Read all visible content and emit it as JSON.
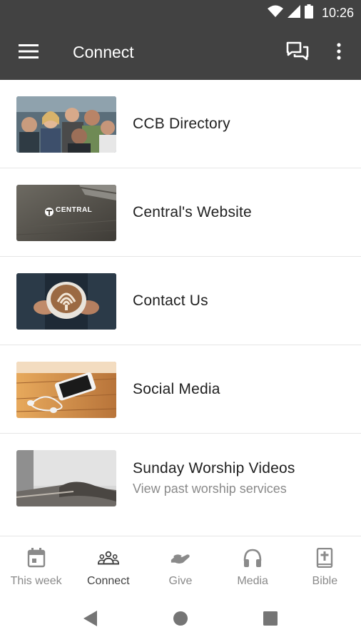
{
  "status_bar": {
    "time": "10:26",
    "icons": [
      "wifi-icon",
      "signal-icon",
      "battery-icon"
    ],
    "background": "#424242"
  },
  "app_bar": {
    "title": "Connect",
    "icons": [
      "menu-icon",
      "chat-icon",
      "more-vert-icon"
    ],
    "background": "#424242"
  },
  "list": {
    "items": [
      {
        "title": "CCB Directory",
        "subtitle": "",
        "thumbnail": "group-people-photo"
      },
      {
        "title": "Central's Website",
        "subtitle": "",
        "thumbnail": "central-logo-photo",
        "thumbnail_text": "CENTRAL"
      },
      {
        "title": "Contact Us",
        "subtitle": "",
        "thumbnail": "latte-cup-photo"
      },
      {
        "title": "Social Media",
        "subtitle": "",
        "thumbnail": "phone-earbuds-photo"
      },
      {
        "title": "Sunday Worship Videos",
        "subtitle": "View past worship services",
        "thumbnail": "open-bible-photo"
      }
    ]
  },
  "bottom_nav": {
    "active": "Connect",
    "items": [
      {
        "label": "This week",
        "icon": "calendar-icon"
      },
      {
        "label": "Connect",
        "icon": "people-icon"
      },
      {
        "label": "Give",
        "icon": "give-hand-icon"
      },
      {
        "label": "Media",
        "icon": "headphones-icon"
      },
      {
        "label": "Bible",
        "icon": "bible-icon"
      }
    ]
  },
  "system_nav": {
    "icons": [
      "back-icon",
      "home-icon",
      "recents-icon"
    ]
  }
}
